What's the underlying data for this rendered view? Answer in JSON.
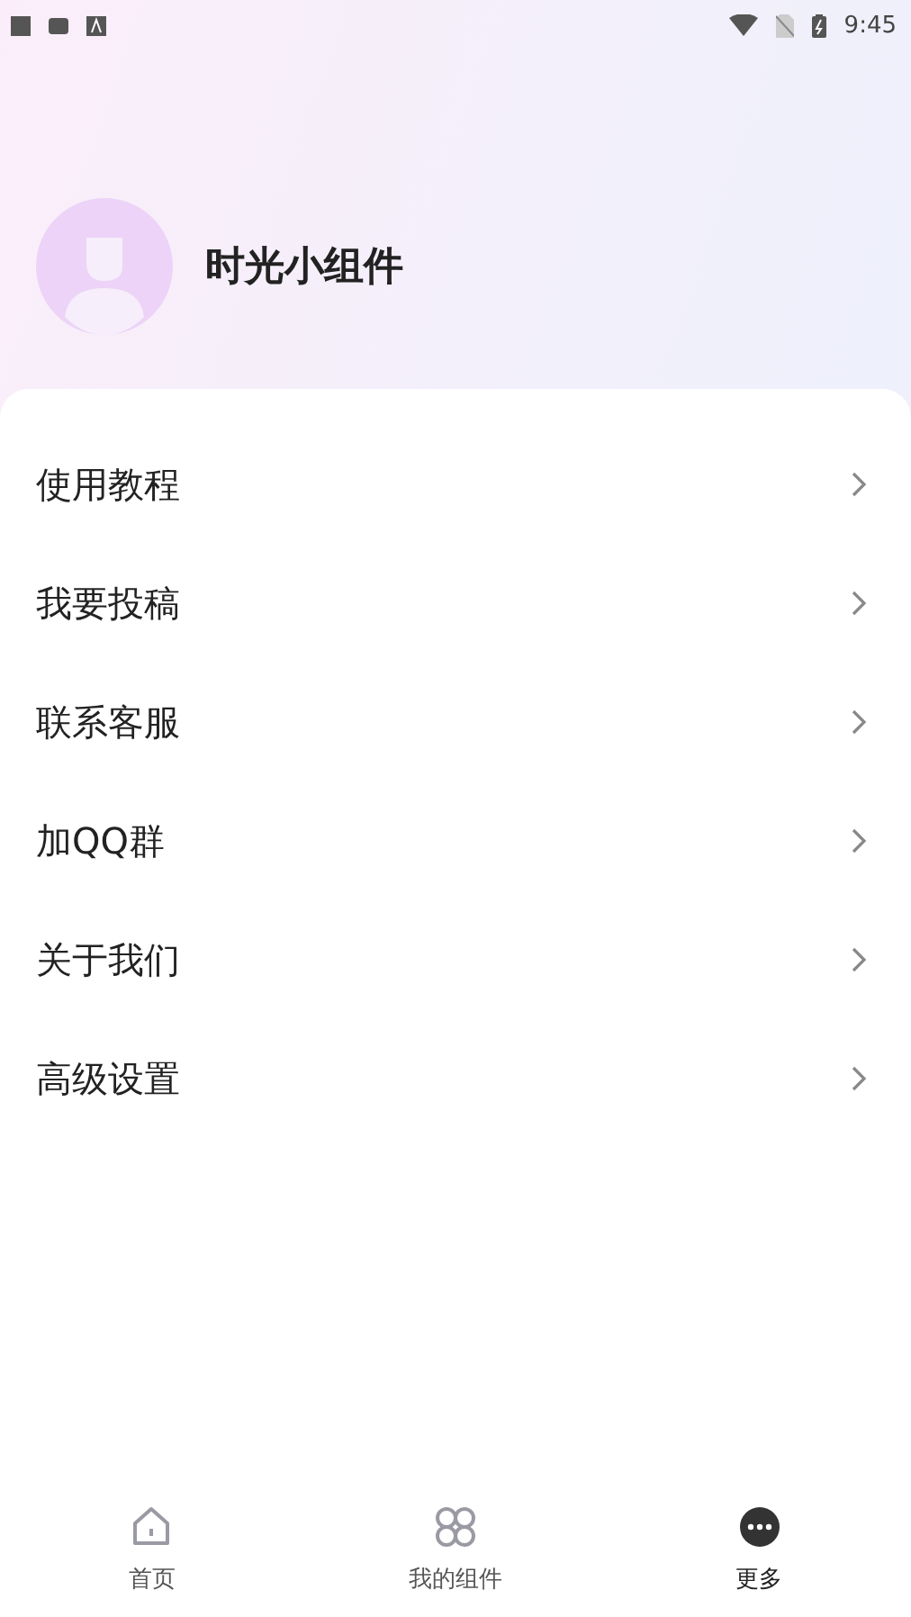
{
  "status_bar": {
    "time": "9:45"
  },
  "profile": {
    "name": "时光小组件"
  },
  "menu": [
    {
      "label": "使用教程"
    },
    {
      "label": "我要投稿"
    },
    {
      "label": "联系客服"
    },
    {
      "label": "加QQ群"
    },
    {
      "label": "关于我们"
    },
    {
      "label": "高级设置"
    }
  ],
  "tabs": [
    {
      "label": "首页",
      "kind": "home",
      "selected": false
    },
    {
      "label": "我的组件",
      "kind": "widgets",
      "selected": false
    },
    {
      "label": "更多",
      "kind": "more",
      "selected": true
    }
  ]
}
